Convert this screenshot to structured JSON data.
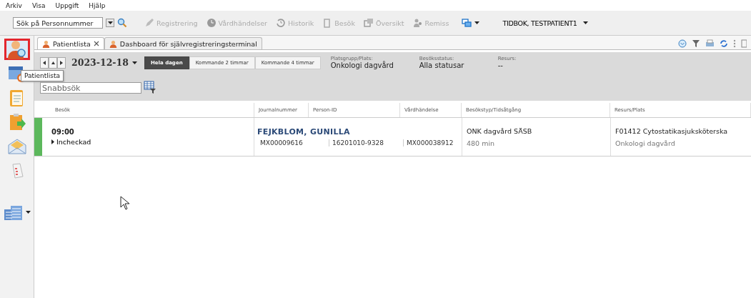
{
  "menu": [
    "Arkiv",
    "Visa",
    "Uppgift",
    "Hjälp"
  ],
  "toolbar": {
    "search": {
      "placeholder": "Sök på Personnummer"
    },
    "buttons": [
      {
        "label": "Registrering",
        "disabled": true
      },
      {
        "label": "Vårdhändelser",
        "disabled": true
      },
      {
        "label": "Historik",
        "disabled": true
      },
      {
        "label": "Besök",
        "disabled": true
      },
      {
        "label": "Översikt",
        "disabled": true
      },
      {
        "label": "Remiss",
        "disabled": true
      }
    ],
    "patient": "TIDBOK, TESTPATIENT1"
  },
  "sidebar": {
    "items": [
      {
        "selected": true
      },
      {
        "selected": false
      },
      {
        "selected": false
      },
      {
        "selected": false
      },
      {
        "selected": false
      },
      {
        "selected": false
      },
      {
        "selected": false
      }
    ],
    "tooltip": "Patientlista"
  },
  "tabs": [
    {
      "label": "Patientlista",
      "selected": true,
      "closable": true
    },
    {
      "label": "Dashboard för självregistreringsterminal",
      "selected": false,
      "closable": false
    }
  ],
  "filter": {
    "date": "2023-12-18",
    "ranges": [
      {
        "label": "Hela dagen",
        "selected": true
      },
      {
        "label": "Kommande 2 timmar",
        "selected": false
      },
      {
        "label": "Kommande 4 timmar",
        "selected": false
      }
    ],
    "fields": [
      {
        "label": "Platsgrupp/Plats:",
        "value": "Onkologi dagvård"
      },
      {
        "label": "Besöksstatus:",
        "value": "Alla statusar"
      },
      {
        "label": "Resurs:",
        "value": "--"
      }
    ],
    "quick_search": {
      "placeholder": "Snabbsök"
    }
  },
  "table": {
    "columns": [
      "Besök",
      "Journalnummer",
      "Person-ID",
      "Vårdhändelse",
      "Besökstyp/Tidsåtgång",
      "Resurs/Plats"
    ],
    "rows": [
      {
        "color": "#5cb85c",
        "time": "09:00",
        "status": "Incheckad",
        "name": "FEJKBLOM, GUNILLA",
        "journal": "MX00009616",
        "person_id": "16201010-9328",
        "vardhandelse": "MX000038912",
        "besokstyp": "ONK dagvård SÄSB",
        "tidsatgang": "480 min",
        "resurs": "F01412 Cytostatikasjuksköterska",
        "plats": "Onkologi dagvård"
      }
    ]
  }
}
